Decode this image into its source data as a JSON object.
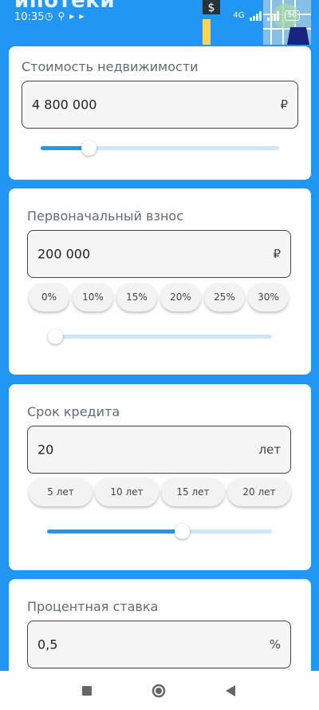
{
  "header": {
    "title": "ипотеки",
    "time": "10:35",
    "battery": "58",
    "network": "4G"
  },
  "property": {
    "title": "Стоимость недвижимости",
    "value": "4 800 000",
    "unit": "₽",
    "slider_fraction": 0.2
  },
  "down_payment": {
    "title": "Первоначальный взнос",
    "value": "200 000",
    "unit": "₽",
    "chips": [
      "0%",
      "10%",
      "15%",
      "20%",
      "25%",
      "30%"
    ],
    "slider_fraction": 0.03
  },
  "term": {
    "title": "Срок кредита",
    "value": "20",
    "unit": "лет",
    "chips": [
      "5 лет",
      "10 лет",
      "15 лет",
      "20 лет"
    ],
    "slider_fraction": 0.6
  },
  "rate": {
    "title": "Процентная ставка",
    "value": "0,5",
    "unit": "%"
  },
  "colors": {
    "accent": "#2196f3",
    "track": "#cfe6fa",
    "card": "#ffffff"
  },
  "icons": {
    "status": [
      "alarm-icon",
      "search-icon",
      "play-icon",
      "play-icon"
    ],
    "nav": [
      "recents-square-icon",
      "home-circle-icon",
      "back-triangle-icon"
    ]
  }
}
